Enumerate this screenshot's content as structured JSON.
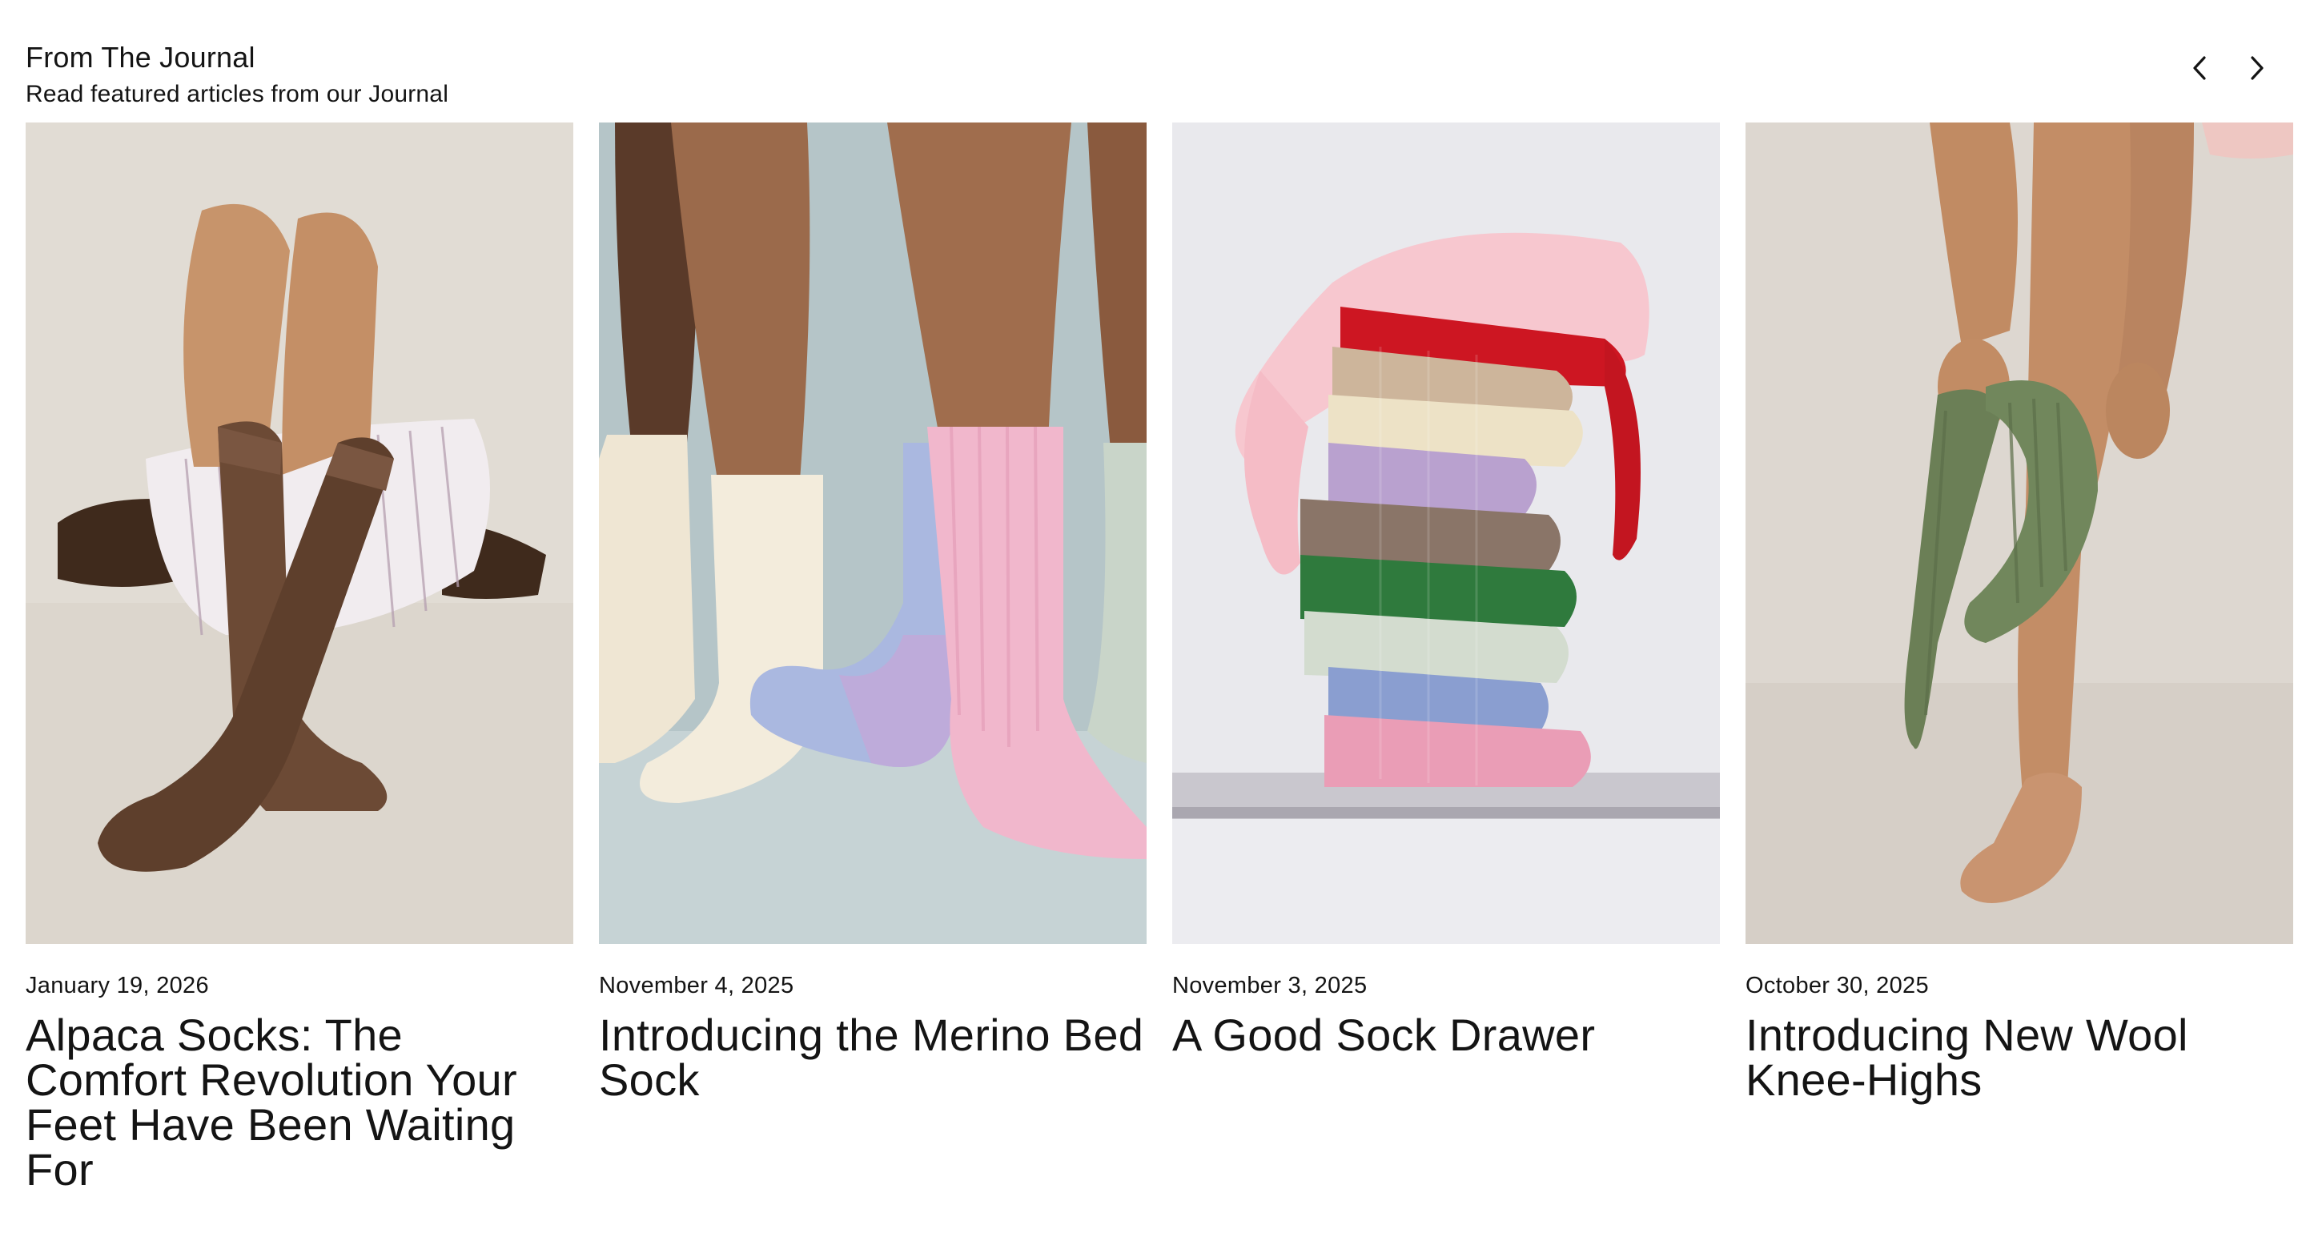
{
  "section": {
    "title": "From The Journal",
    "subtitle": "Read featured articles from our Journal"
  },
  "nav": {
    "prev_icon": "chevron-left-icon",
    "next_icon": "chevron-right-icon"
  },
  "articles": [
    {
      "date": "January 19, 2026",
      "title": "Alpaca Socks: The Comfort Revolution Your Feet Have Been Waiting For",
      "image": "brown alpaca socks on crossed legs",
      "bg": "#e2ddd5"
    },
    {
      "date": "November 4, 2025",
      "title": "Introducing the Merino Bed Sock",
      "image": "pastel merino bed socks",
      "bg": "#b6c6c9"
    },
    {
      "date": "November 3, 2025",
      "title": "A Good Sock Drawer",
      "image": "stack of folded colourful socks",
      "bg": "#e8e8ec"
    },
    {
      "date": "October 30, 2025",
      "title": "Introducing New Wool Knee-Highs",
      "image": "green wool knee-high sock",
      "bg": "#dcd6cf"
    }
  ]
}
